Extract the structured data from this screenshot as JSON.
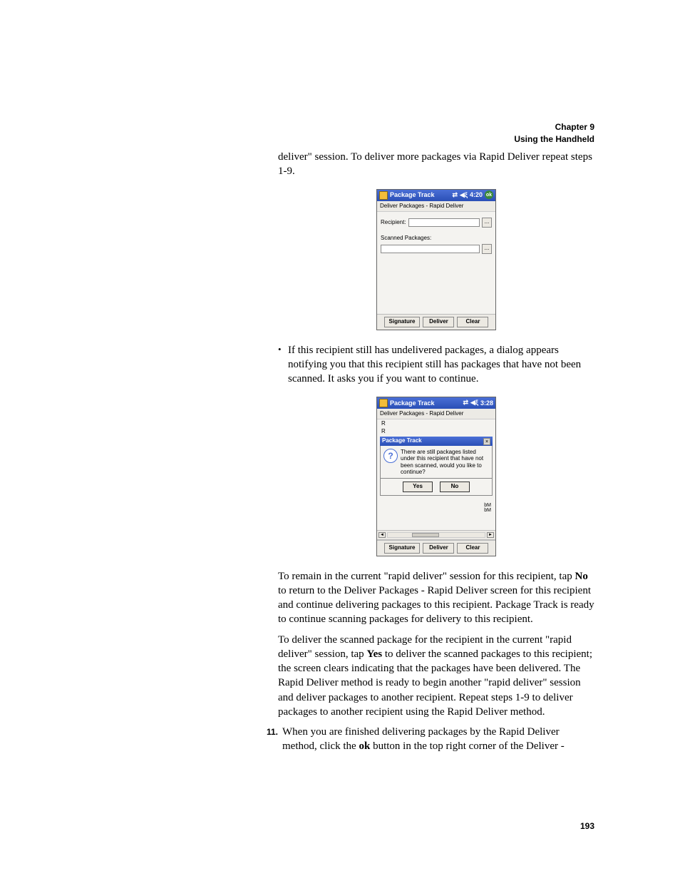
{
  "header": {
    "chapter": "Chapter 9",
    "title": "Using the Handheld"
  },
  "intro_para": "deliver\" session. To deliver more packages via Rapid Deliver repeat steps 1-9.",
  "bullet1": "If this recipient still has undelivered packages, a dialog appears notifying you that this recipient still has packages that have not been scanned. It asks you if you want to continue.",
  "para2_a": "To remain in the current \"rapid deliver\" session for this recipient, tap ",
  "para2_no": "No",
  "para2_b": " to return to the Deliver Packages - Rapid Deliver screen for this recipient and continue delivering packages to this recipient. Package Track is ready to continue scanning packages for delivery to this recipient.",
  "para3_a": "To deliver the scanned package for the recipient in the current \"rapid deliver\" session, tap ",
  "para3_yes": "Yes",
  "para3_b": " to deliver the scanned packages to this recipient; the screen clears indicating that the packages have been delivered. The Rapid Deliver method is ready to begin another \"rapid deliver\" session and deliver packages to another recipient. Repeat steps 1-9 to deliver packages to another recipient using the Rapid Deliver method.",
  "step11": {
    "num": "11.",
    "text_a": "When you are finished delivering packages by the Rapid Deliver method, click the ",
    "text_ok": "ok",
    "text_b": " button in the top right corner of the Deliver -"
  },
  "page_number": "193",
  "pda1": {
    "title": "Package Track",
    "time": "4:20",
    "ok": "ok",
    "subtitle": "Deliver Packages - Rapid Deliver",
    "recipient_label": "Recipient:",
    "scanned_label": "Scanned Packages:",
    "ellipsis": "...",
    "btn_sig": "Signature",
    "btn_deliver": "Deliver",
    "btn_clear": "Clear"
  },
  "pda2": {
    "title": "Package Track",
    "time": "3:28",
    "subtitle": "Deliver Packages - Rapid Deliver",
    "top_label_r": "R",
    "top_label_r2": "R",
    "dlg_title": "Package Track",
    "dlg_msg": "There are still packages listed under this recipient that have not been scanned, would you like to continue?",
    "dlg_yes": "Yes",
    "dlg_no": "No",
    "side_mark": "bM",
    "btn_sig": "Signature",
    "btn_deliver": "Deliver",
    "btn_clear": "Clear",
    "arrow_left": "◄",
    "arrow_right": "►"
  }
}
